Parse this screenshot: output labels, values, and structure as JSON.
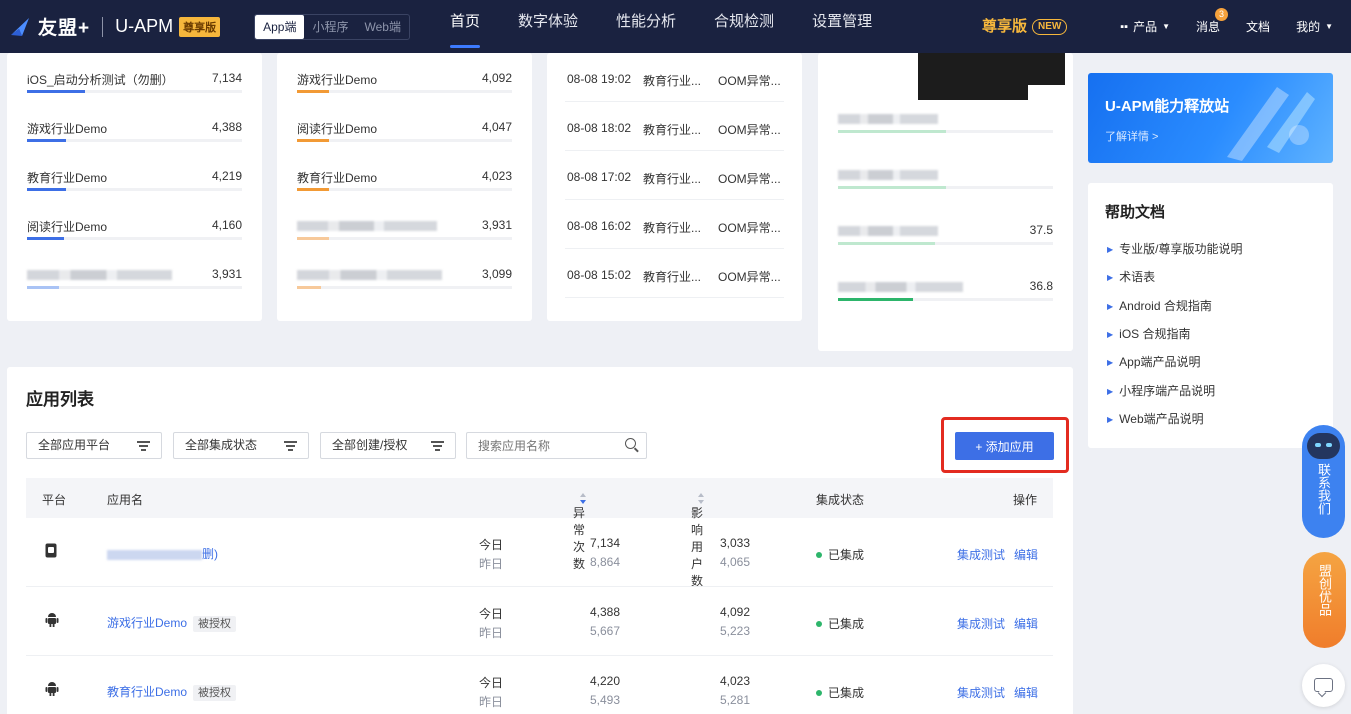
{
  "header": {
    "brand": "友盟+",
    "product": "U-APM",
    "edition_badge": "尊享版",
    "platforms": [
      "App端",
      "小程序",
      "Web端"
    ],
    "nav": [
      "首页",
      "数字体验",
      "性能分析",
      "合规检测",
      "设置管理"
    ],
    "premium": "尊享版",
    "new_tag": "NEW",
    "products": "产品",
    "messages": "消息",
    "message_count": "3",
    "docs": "文档",
    "mine": "我的"
  },
  "rank_col1": [
    {
      "name": "iOS_启动分析测试（勿删）",
      "value": "7,134",
      "ratio": 0.27
    },
    {
      "name": "游戏行业Demo",
      "value": "4,388",
      "ratio": 0.18
    },
    {
      "name": "教育行业Demo",
      "value": "4,219",
      "ratio": 0.18
    },
    {
      "name": "阅读行业Demo",
      "value": "4,160",
      "ratio": 0.17
    },
    {
      "name": "",
      "value": "3,931",
      "ratio": 0.15
    }
  ],
  "rank_col2": [
    {
      "name": "游戏行业Demo",
      "value": "4,092",
      "ratio": 0.15
    },
    {
      "name": "阅读行业Demo",
      "value": "4,047",
      "ratio": 0.15
    },
    {
      "name": "教育行业Demo",
      "value": "4,023",
      "ratio": 0.15
    },
    {
      "name": "",
      "value": "3,931",
      "ratio": 0.15
    },
    {
      "name": "",
      "value": "3,099",
      "ratio": 0.11
    }
  ],
  "events": [
    {
      "time": "08-08 19:02",
      "app": "教育行业...",
      "type": "OOM异常..."
    },
    {
      "time": "08-08 18:02",
      "app": "教育行业...",
      "type": "OOM异常..."
    },
    {
      "time": "08-08 17:02",
      "app": "教育行业...",
      "type": "OOM异常..."
    },
    {
      "time": "08-08 16:02",
      "app": "教育行业...",
      "type": "OOM异常..."
    },
    {
      "time": "08-08 15:02",
      "app": "教育行业...",
      "type": "OOM异常..."
    }
  ],
  "metrics": [
    {
      "value": "",
      "ratio": 0.5
    },
    {
      "value": "",
      "ratio": 0.5
    },
    {
      "value": "37.5",
      "ratio": 0.45
    },
    {
      "value": "36.8",
      "ratio": 0.35
    }
  ],
  "banner": {
    "title": "U-APM能力释放站",
    "link": "了解详情 >"
  },
  "help": {
    "title": "帮助文档",
    "items": [
      "专业版/尊享版功能说明",
      "术语表",
      "Android 合规指南",
      "iOS 合规指南",
      "App端产品说明",
      "小程序端产品说明",
      "Web端产品说明"
    ]
  },
  "app_list": {
    "title": "应用列表",
    "filters": [
      "全部应用平台",
      "全部集成状态",
      "全部创建/授权"
    ],
    "search_placeholder": "搜索应用名称",
    "add_button": "+ 添加应用",
    "columns": {
      "platform": "平台",
      "name": "应用名",
      "errors": "异常次数",
      "users": "影响用户数",
      "status": "集成状态",
      "actions": "操作"
    },
    "rows": [
      {
        "platform": "ios-icon",
        "name": "删)",
        "tag": "",
        "today_label": "今日",
        "yesterday_label": "昨日",
        "errors_today": "7,134",
        "errors_yesterday": "8,864",
        "users_today": "3,033",
        "users_yesterday": "4,065",
        "status": "已集成",
        "action1": "集成测试",
        "action2": "编辑"
      },
      {
        "platform": "android-icon",
        "name": "游戏行业Demo",
        "tag": "被授权",
        "today_label": "今日",
        "yesterday_label": "昨日",
        "errors_today": "4,388",
        "errors_yesterday": "5,667",
        "users_today": "4,092",
        "users_yesterday": "5,223",
        "status": "已集成",
        "action1": "集成测试",
        "action2": "编辑"
      },
      {
        "platform": "android-icon",
        "name": "教育行业Demo",
        "tag": "被授权",
        "today_label": "今日",
        "yesterday_label": "昨日",
        "errors_today": "4,220",
        "errors_yesterday": "5,493",
        "users_today": "4,023",
        "users_yesterday": "5,281",
        "status": "已集成",
        "action1": "集成测试",
        "action2": "编辑"
      }
    ]
  },
  "widgets": {
    "contact": "联系我们",
    "promo": "盟创优品"
  },
  "colors": {
    "nav_bg": "#1a2240",
    "accent": "#3d6fe6",
    "gold": "#f6b73c",
    "blue_bar": "#3d6fe6",
    "orange_bar": "#f29a35",
    "green_bar": "#2db56b",
    "highlight": "#e32b20"
  }
}
